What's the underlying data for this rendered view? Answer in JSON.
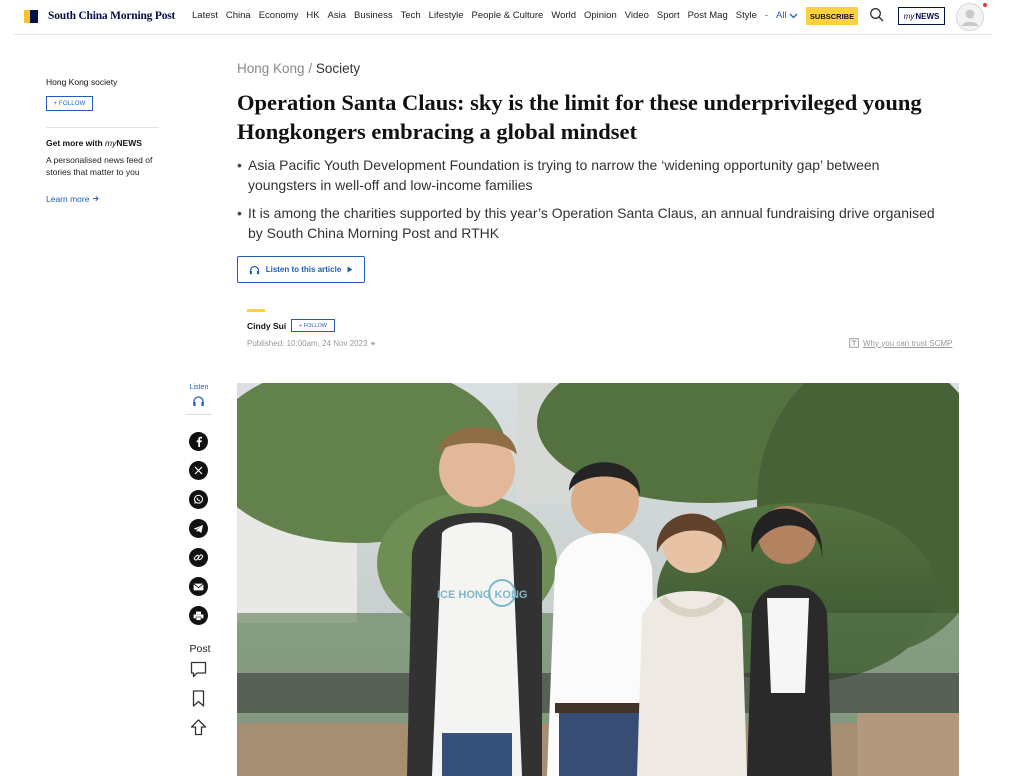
{
  "header": {
    "brand": "South China Morning Post",
    "nav": [
      "Latest",
      "China",
      "Economy",
      "HK",
      "Asia",
      "Business",
      "Tech",
      "Lifestyle",
      "People & Culture",
      "World",
      "Opinion",
      "Video",
      "Sport",
      "Post Mag",
      "Style"
    ],
    "nav_more": "All",
    "subscribe": "SUBSCRIBE",
    "mynews_prefix": "my",
    "mynews_suffix": "NEWS"
  },
  "sidebar": {
    "topic": "Hong Kong society",
    "follow": "+ FOLLOW",
    "getmore_prefix": "Get more with ",
    "getmore_my": "my",
    "getmore_news": "NEWS",
    "description": "A personalised news feed of stories that matter to you",
    "learn_more": "Learn more"
  },
  "article": {
    "breadcrumb_parent": "Hong Kong",
    "breadcrumb_sep": " / ",
    "breadcrumb_section": "Society",
    "headline": "Operation Santa Claus: sky is the limit for these underprivileged young Hongkongers embracing a global mindset",
    "summary": [
      "Asia Pacific Youth Development Foundation is trying to narrow the ‘widening opportunity gap’ between youngsters in well-off and low-income families",
      "It is among the charities supported by this year’s Operation Santa Claus, an annual fundraising drive organised by South China Morning Post and RTHK"
    ],
    "listen_label": "Listen to this article",
    "author": "Cindy Sui",
    "author_follow": "+ FOLLOW",
    "published": "Published: 10:00am, 24 Nov 2023",
    "trust_link": "Why you can trust SCMP"
  },
  "rail": {
    "listen": "Listen",
    "post": "Post"
  },
  "photo": {
    "shirt_text": "ICE HONG KONG"
  },
  "colors": {
    "brand_navy": "#001246",
    "brand_yellow": "#fcd33e",
    "link_blue": "#1f5fb8"
  }
}
